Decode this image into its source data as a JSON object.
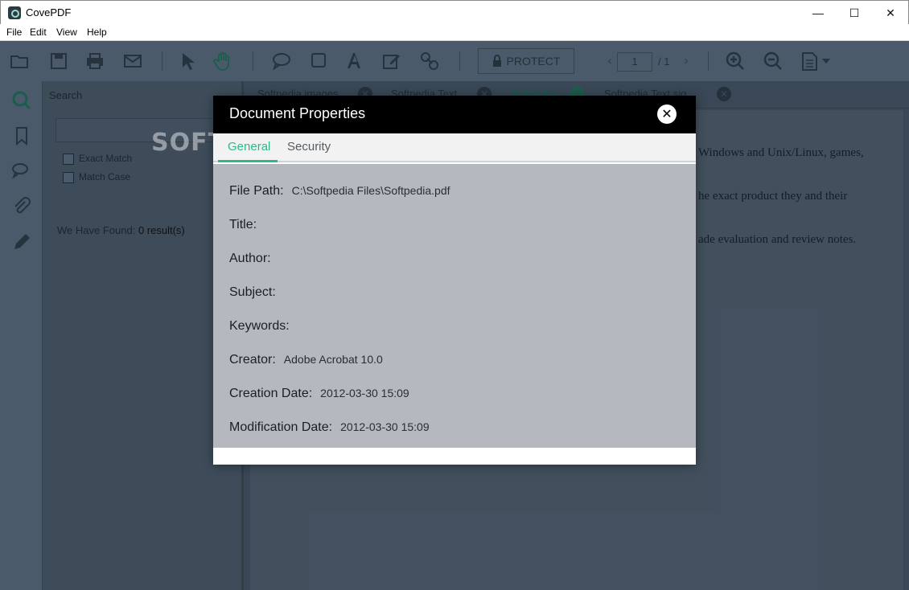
{
  "window": {
    "title": "CovePDF",
    "min_glyph": "—",
    "max_glyph": "☐",
    "close_glyph": "✕"
  },
  "menu": {
    "items": [
      "File",
      "Edit",
      "View",
      "Help"
    ]
  },
  "toolbar": {
    "icons": [
      "open-folder-icon",
      "save-icon",
      "print-icon",
      "email-icon",
      "select-arrow-icon",
      "hand-tool-icon",
      "comment-icon",
      "rectangle-icon",
      "text-tool-icon",
      "edit-icon",
      "link-icon",
      "zoom-in-icon",
      "zoom-out-icon",
      "page-view-icon"
    ],
    "protect_label": "PROTECT",
    "page_current": "1",
    "page_total": "/ 1"
  },
  "rail": {
    "icons": [
      "search-icon",
      "bookmark-icon",
      "comments-icon",
      "attachment-icon",
      "pencil-icon"
    ]
  },
  "search_panel": {
    "title": "Search",
    "input_value": "",
    "exact_match_label": "Exact Match",
    "match_case_label": "Match Case",
    "found_prefix": "We Have Found:",
    "found_count": "0 result(s)"
  },
  "doc_tabs": [
    {
      "label": "Softpedia images"
    },
    {
      "label": "Softpedia Text"
    },
    {
      "label": "Softpedia"
    },
    {
      "label": "Softpedia Text sig..."
    }
  ],
  "doc_page": {
    "lines": [
      "Windows and Unix/Linux, games,",
      "he exact product they and their",
      "ade evaluation and review notes."
    ]
  },
  "watermark": "SOFTPEDIA",
  "dialog": {
    "title": "Document Properties",
    "tabs": [
      "General",
      "Security"
    ],
    "active_tab": "General",
    "properties": [
      {
        "key": "File Path:",
        "value": "C:\\Softpedia Files\\Softpedia.pdf"
      },
      {
        "key": "Title:",
        "value": ""
      },
      {
        "key": "Author:",
        "value": ""
      },
      {
        "key": "Subject:",
        "value": ""
      },
      {
        "key": "Keywords:",
        "value": ""
      },
      {
        "key": "Creator:",
        "value": "Adobe Acrobat 10.0"
      },
      {
        "key": "Creation Date:",
        "value": "2012-03-30 15:09"
      },
      {
        "key": "Modification Date:",
        "value": "2012-03-30 15:09"
      }
    ]
  },
  "colors": {
    "accent": "#33b58a",
    "dialog_header": "#000000",
    "dialog_body": "#b5b8be"
  }
}
